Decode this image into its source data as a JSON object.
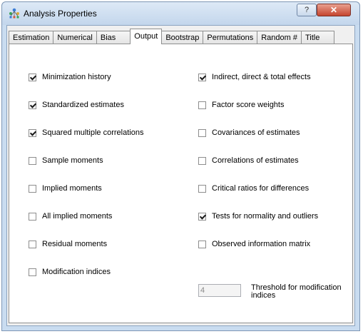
{
  "window": {
    "title": "Analysis Properties",
    "help_glyph": "?",
    "close_glyph": "✕"
  },
  "tabs": [
    {
      "label": "Estimation",
      "active": false
    },
    {
      "label": "Numerical",
      "active": false
    },
    {
      "label": "Bias",
      "active": false
    },
    {
      "label": "Output",
      "active": true
    },
    {
      "label": "Bootstrap",
      "active": false
    },
    {
      "label": "Permutations",
      "active": false
    },
    {
      "label": "Random #",
      "active": false
    },
    {
      "label": "Title",
      "active": false
    }
  ],
  "left_options": [
    {
      "label": "Minimization history",
      "checked": true
    },
    {
      "label": "Standardized estimates",
      "checked": true
    },
    {
      "label": "Squared multiple correlations",
      "checked": true
    },
    {
      "label": "Sample moments",
      "checked": false
    },
    {
      "label": "Implied moments",
      "checked": false
    },
    {
      "label": "All implied moments",
      "checked": false
    },
    {
      "label": "Residual moments",
      "checked": false
    },
    {
      "label": "Modification indices",
      "checked": false
    }
  ],
  "right_options": [
    {
      "label": "Indirect, direct & total effects",
      "checked": true
    },
    {
      "label": "Factor score weights",
      "checked": false
    },
    {
      "label": "Covariances of estimates",
      "checked": false
    },
    {
      "label": "Correlations of estimates",
      "checked": false
    },
    {
      "label": "Critical ratios for differences",
      "checked": false
    },
    {
      "label": "Tests for normality and outliers",
      "checked": true
    },
    {
      "label": "Observed information matrix",
      "checked": false
    }
  ],
  "threshold": {
    "value": "4",
    "label": "Threshold for modification indices"
  }
}
